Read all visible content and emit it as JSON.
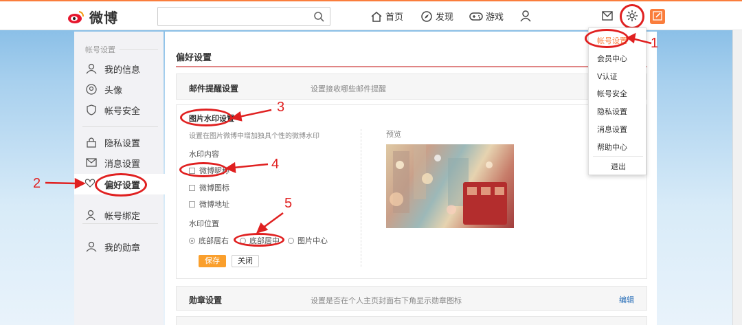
{
  "topbar": {
    "logo_text": "微博",
    "search_placeholder": "",
    "nav": [
      {
        "label": "首页",
        "icon": "home-icon"
      },
      {
        "label": "发现",
        "icon": "compass-icon"
      },
      {
        "label": "游戏",
        "icon": "gamepad-icon"
      }
    ],
    "accent_color": "#fa7d3c"
  },
  "sidebar": {
    "section_title": "帐号设置",
    "items": [
      {
        "label": "我的信息",
        "icon": "user-icon"
      },
      {
        "label": "头像",
        "icon": "avatar-icon"
      },
      {
        "label": "帐号安全",
        "icon": "shield-icon"
      },
      {
        "label": "隐私设置",
        "icon": "lock-icon"
      },
      {
        "label": "消息设置",
        "icon": "message-icon"
      },
      {
        "label": "偏好设置",
        "icon": "heart-icon",
        "active": true
      },
      {
        "label": "帐号绑定",
        "icon": "link-user-icon"
      },
      {
        "label": "我的勋章",
        "icon": "medal-icon"
      }
    ]
  },
  "main": {
    "title": "偏好设置",
    "email_section": {
      "title": "邮件提醒设置",
      "desc": "设置接收哪些邮件提醒"
    },
    "watermark": {
      "title": "图片水印设置",
      "desc": "设置在图片微博中增加独具个性的微博水印",
      "content_label": "水印内容",
      "options": [
        "微博昵称",
        "微博图标",
        "微博地址"
      ],
      "position_label": "水印位置",
      "positions": [
        "底部居右",
        "底部居中",
        "图片中心"
      ],
      "selected_position": "底部居右",
      "preview_label": "预览",
      "save_label": "保存",
      "close_label": "关闭"
    },
    "medal_section": {
      "title": "勋章设置",
      "desc": "设置是否在个人主页封面右下角显示勋章图标",
      "edit_label": "编辑"
    }
  },
  "dropdown": {
    "items": [
      "帐号设置",
      "会员中心",
      "V认证",
      "帐号安全",
      "隐私设置",
      "消息设置",
      "帮助中心",
      "退出"
    ],
    "active": "帐号设置"
  },
  "annotations": {
    "numbers": [
      "1",
      "2",
      "3",
      "4",
      "5"
    ],
    "color": "#e02020"
  }
}
